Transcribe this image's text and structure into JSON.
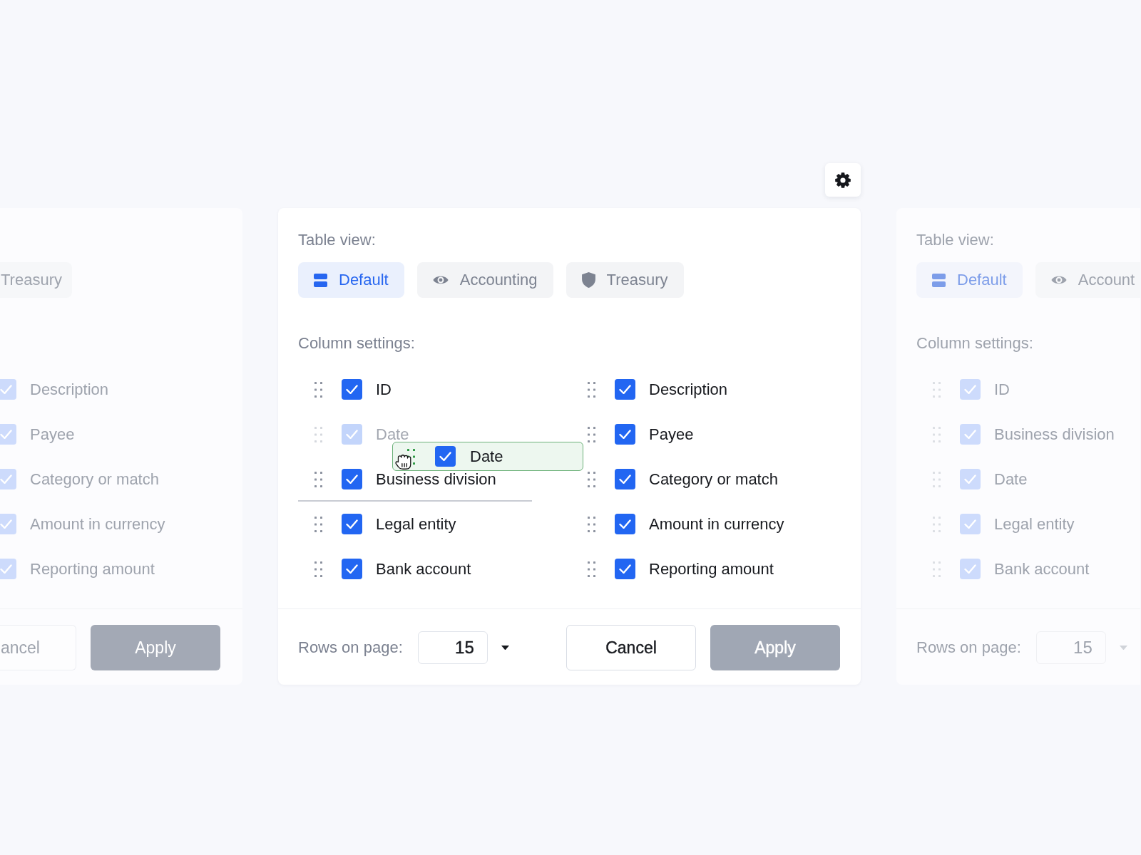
{
  "main_panel": {
    "table_view": {
      "label": "Table view:",
      "tabs": [
        {
          "label": "Default",
          "selected": true
        },
        {
          "label": "Accounting",
          "selected": false
        },
        {
          "label": "Treasury",
          "selected": false
        }
      ]
    },
    "column_settings": {
      "label": "Column settings:",
      "columns": [
        {
          "items": [
            {
              "label": "ID",
              "checked": true,
              "dragging": false,
              "drop_target": false
            },
            {
              "label": "Date",
              "checked": true,
              "dragging": true,
              "drop_target": false
            },
            {
              "label": "Business division",
              "checked": true,
              "dragging": false,
              "drop_target": true
            },
            {
              "label": "Legal entity",
              "checked": true,
              "dragging": false,
              "drop_target": false
            },
            {
              "label": "Bank account",
              "checked": true,
              "dragging": false,
              "drop_target": false
            }
          ]
        },
        {
          "items": [
            {
              "label": "Description",
              "checked": true,
              "dragging": false,
              "drop_target": false
            },
            {
              "label": "Payee",
              "checked": true,
              "dragging": false,
              "drop_target": false
            },
            {
              "label": "Category or match",
              "checked": true,
              "dragging": false,
              "drop_target": false
            },
            {
              "label": "Amount in currency",
              "checked": true,
              "dragging": false,
              "drop_target": false
            },
            {
              "label": "Reporting amount",
              "checked": true,
              "dragging": false,
              "drop_target": false
            }
          ]
        }
      ],
      "drag_card": {
        "label": "Date",
        "checked": true
      }
    },
    "footer": {
      "rows_label": "Rows on page:",
      "rows_value": "15",
      "buttons": [
        {
          "label": "Cancel",
          "kind": "secondary",
          "disabled": false
        },
        {
          "label": "Apply",
          "kind": "primary",
          "disabled": true
        }
      ]
    }
  },
  "previous_panel": {
    "tabs": [
      {
        "label": "Treasury",
        "selected": false
      }
    ],
    "columns": [
      {
        "label": "Description",
        "checked": true
      },
      {
        "label": "Payee",
        "checked": true
      },
      {
        "label": "Category or match",
        "checked": true
      },
      {
        "label": "Amount in currency",
        "checked": true
      },
      {
        "label": "Reporting amount",
        "checked": true
      }
    ],
    "buttons": [
      {
        "label": "ancel",
        "kind": "secondary",
        "disabled": false
      },
      {
        "label": "Apply",
        "kind": "primary",
        "disabled": true
      }
    ]
  },
  "next_panel": {
    "table_view_label": "Table view:",
    "tabs": [
      {
        "label": "Default",
        "selected": true
      },
      {
        "label": "Account",
        "selected": false
      }
    ],
    "column_settings_label": "Column settings:",
    "columns": [
      {
        "label": "ID",
        "checked": true
      },
      {
        "label": "Business division",
        "checked": true
      },
      {
        "label": "Date",
        "checked": true
      },
      {
        "label": "Legal entity",
        "checked": true
      },
      {
        "label": "Bank account",
        "checked": true
      }
    ],
    "rows_label": "Rows on page:",
    "rows_value": "15"
  }
}
